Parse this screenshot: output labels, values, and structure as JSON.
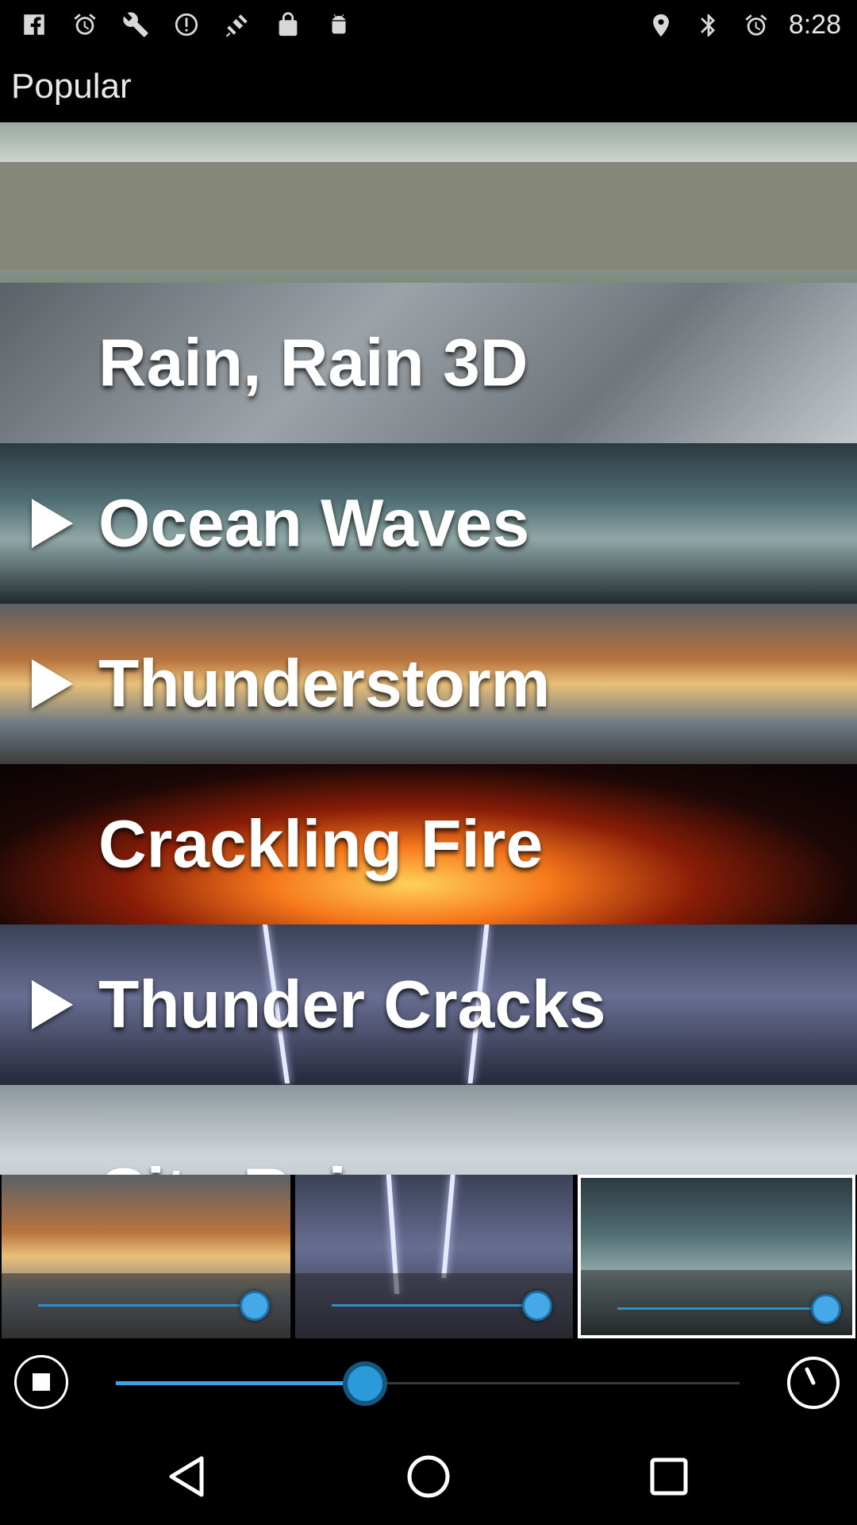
{
  "status_bar": {
    "time": "8:28",
    "left_icons": [
      "facebook-icon",
      "alarm-icon",
      "wrench-icon",
      "sync-icon",
      "fake-gps-satellite-icon",
      "lock-icon",
      "android-icon"
    ],
    "right_icons": [
      "location-icon",
      "bluetooth-icon",
      "alarm-icon"
    ]
  },
  "header": {
    "title": "Popular"
  },
  "sounds": [
    {
      "label": "",
      "has_play": false,
      "theme": "banner"
    },
    {
      "label": "Rain, Rain 3D",
      "has_play": false,
      "theme": "rain"
    },
    {
      "label": "Ocean Waves",
      "has_play": true,
      "theme": "ocean"
    },
    {
      "label": "Thunderstorm",
      "has_play": true,
      "theme": "thunderstorm"
    },
    {
      "label": "Crackling Fire",
      "has_play": false,
      "theme": "fire"
    },
    {
      "label": "Thunder Cracks",
      "has_play": true,
      "theme": "thunder"
    },
    {
      "label": "City Rain",
      "has_play": false,
      "theme": "city"
    }
  ],
  "mixer": [
    {
      "sound": "thunderstorm",
      "volume": 0.95,
      "selected": false
    },
    {
      "sound": "thunder",
      "volume": 0.9,
      "selected": false
    },
    {
      "sound": "ocean",
      "volume": 0.95,
      "selected": true
    }
  ],
  "controls": {
    "master_volume": 0.4,
    "accent_color": "#37a6e8"
  },
  "nav": [
    "back-icon",
    "home-icon",
    "recents-icon"
  ]
}
